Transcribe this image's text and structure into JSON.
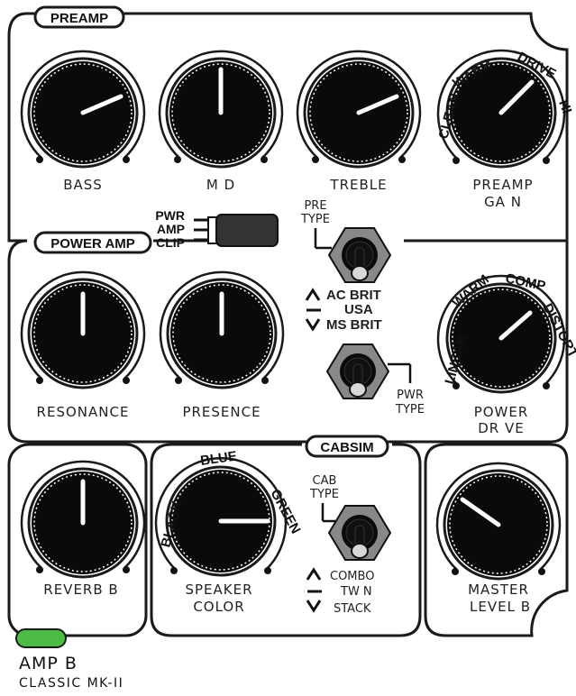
{
  "sections": {
    "preamp": "PREAMP",
    "power_amp": "POWER AMP",
    "cabsim": "CABSIM"
  },
  "knobs": {
    "bass": "BASS",
    "mid": "M D",
    "treble": "TREBLE",
    "preamp_gain_line1": "PREAMP",
    "preamp_gain_line2": "GA N",
    "resonance": "RESONANCE",
    "presence": "PRESENCE",
    "power_drive_line1": "POWER",
    "power_drive_line2": "DR VE",
    "reverb": "REVERB B",
    "speaker_color_line1": "SPEAKER",
    "speaker_color_line2": "COLOR",
    "master_level_line1": "MASTER",
    "master_level_line2": "LEVEL B"
  },
  "gain_scale": [
    "CLEAN",
    "WARM",
    "DRIVE",
    "HI"
  ],
  "drive_scale": [
    "LINEAR",
    "WARM",
    "COMP",
    "DISTORT"
  ],
  "color_scale": [
    "BLACK",
    "BLUE",
    "GREEN"
  ],
  "clip_indicator": {
    "line1": "PWR",
    "line2": "AMP",
    "line3": "CLIP"
  },
  "switches": {
    "pre_type": {
      "line1": "PRE",
      "line2": "TYPE"
    },
    "pwr_type": {
      "line1": "PWR",
      "line2": "TYPE"
    },
    "pwr_positions": [
      "AC BRIT",
      "USA",
      "MS BRIT"
    ],
    "cab_type": {
      "line1": "CAB",
      "line2": "TYPE"
    },
    "cab_positions": [
      "COMBO",
      "TW N",
      "STACK"
    ]
  },
  "footer": {
    "title": "AMP B",
    "subtitle": "CLASSIC MK-II"
  },
  "colors": {
    "led": "#4cbc45",
    "knob": "#0a0a0a",
    "panel_line": "#1a1a1a"
  }
}
